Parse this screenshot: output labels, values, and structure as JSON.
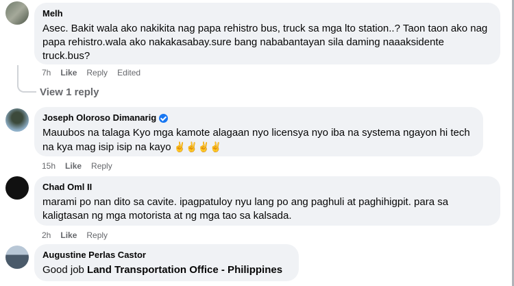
{
  "comments": [
    {
      "author": "Melh",
      "text": "Asec. Bakit wala ako nakikita nag papa rehistro bus, truck sa mga lto station..? Taon taon ako nag papa rehistro.wala ako nakakasabay.sure bang nababantayan sila daming naaaksidente truck.bus?",
      "time": "7h",
      "like": "Like",
      "reply": "Reply",
      "edited": "Edited",
      "view_replies": "View 1 reply"
    },
    {
      "author": "Joseph Oloroso Dimanarig",
      "verified": true,
      "text": "Mauubos na talaga Kyo mga kamote alagaan nyo licensya nyo iba na systema ngayon hi tech na kya mag isip isip na kayo",
      "emojis": "✌✌✌✌",
      "time": "15h",
      "like": "Like",
      "reply": "Reply"
    },
    {
      "author": "Chad Oml II",
      "text": "marami po nan dito sa cavite. ipagpatuloy nyu lang po ang paghuli at paghihigpit. para sa kaligtasan ng mga motorista at ng mga tao sa kalsada.",
      "time": "2h",
      "like": "Like",
      "reply": "Reply"
    },
    {
      "author": "Augustine Perlas Castor",
      "text_prefix": "Good job ",
      "mention": "Land Transportation Office - Philippines"
    }
  ]
}
